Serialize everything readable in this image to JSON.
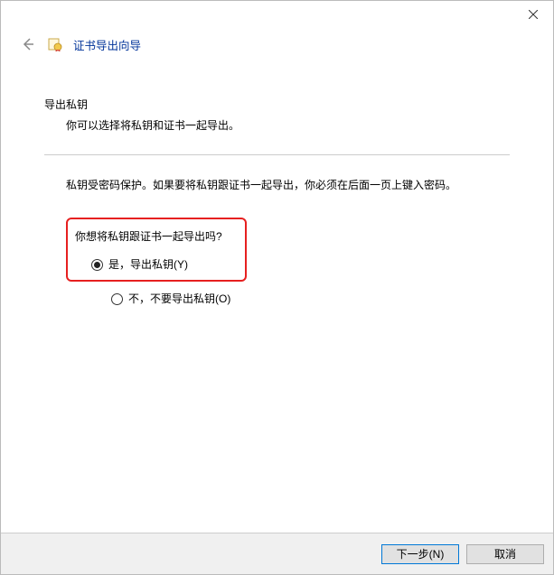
{
  "window": {
    "title": "证书导出向导"
  },
  "page": {
    "section_title": "导出私钥",
    "section_sub": "你可以选择将私钥和证书一起导出。",
    "info": "私钥受密码保护。如果要将私钥跟证书一起导出，你必须在后面一页上键入密码。",
    "question": "你想将私钥跟证书一起导出吗?"
  },
  "options": {
    "yes": "是，导出私钥(Y)",
    "no": "不，不要导出私钥(O)"
  },
  "footer": {
    "next": "下一步(N)",
    "cancel": "取消"
  }
}
